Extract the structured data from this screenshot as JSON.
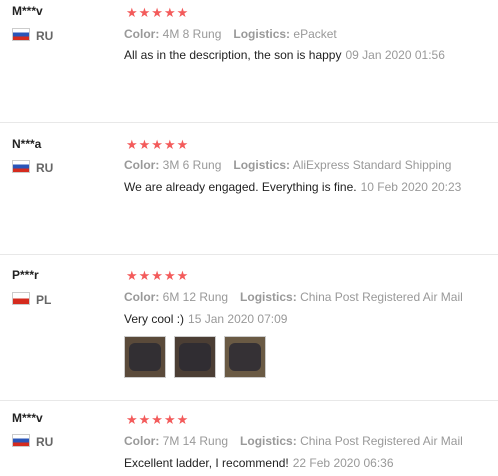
{
  "reviews": [
    {
      "user": "M***v",
      "country": "RU",
      "stars": "★★★★★",
      "color_label": "Color:",
      "color": "4M 8 Rung",
      "logistics_label": "Logistics:",
      "logistics": "ePacket",
      "text": "All as in the description, the son is happy",
      "date": "09 Jan 2020 01:56"
    },
    {
      "user": "N***a",
      "country": "RU",
      "stars": "★★★★★",
      "color_label": "Color:",
      "color": "3M 6 Rung",
      "logistics_label": "Logistics:",
      "logistics": "AliExpress Standard Shipping",
      "text": "We are already engaged. Everything is fine.",
      "date": "10 Feb 2020 20:23"
    },
    {
      "user": "P***r",
      "country": "PL",
      "stars": "★★★★★",
      "color_label": "Color:",
      "color": "6M 12 Rung",
      "logistics_label": "Logistics:",
      "logistics": "China Post Registered Air Mail",
      "text": "Very cool :)",
      "date": "15 Jan 2020 07:09"
    },
    {
      "user": "M***v",
      "country": "RU",
      "stars": "★★★★★",
      "color_label": "Color:",
      "color": "7M 14 Rung",
      "logistics_label": "Logistics:",
      "logistics": "China Post Registered Air Mail",
      "text": "Excellent ladder, I recommend!",
      "date": "22 Feb 2020 06:36"
    }
  ],
  "icons": {
    "star": "star-icon",
    "flag_ru": "flag-ru-icon",
    "flag_pl": "flag-pl-icon",
    "photo": "review-photo"
  }
}
